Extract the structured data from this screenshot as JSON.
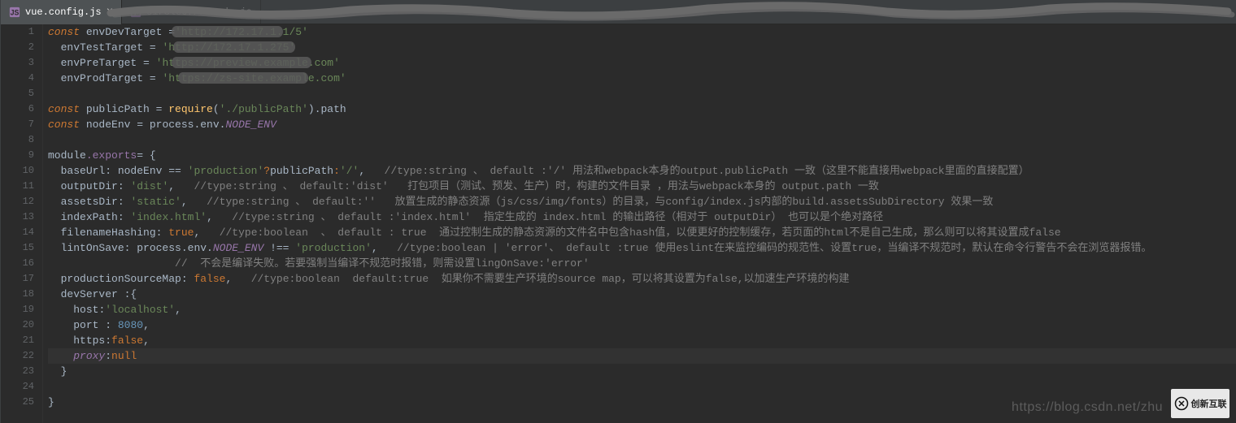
{
  "tabs": {
    "active": {
      "label": "vue.config.js"
    },
    "second": {
      "label": "circleOfFriends.js"
    }
  },
  "code": {
    "l1_const": "const",
    "l1_var": "envDevTarget",
    "l1_eq": " =",
    "l1_str": "'http://172.17.1.1/5'",
    "l2_var": "envTestTarget",
    "l2_eq": " = ",
    "l2_str": "'http://172.17.1.275'",
    "l3_var": "envPreTarget",
    "l3_eq": " = ",
    "l3_str": "'https://preview.example.com'",
    "l4_var": "envProdTarget",
    "l4_eq": " = ",
    "l4_str": "'https://zs-site.example.com'",
    "l6_const": "const",
    "l6_var": "publicPath",
    "l6_eq": " = ",
    "l6_req": "require",
    "l6_arg": "'./publicPath'",
    "l6_tail": ").path",
    "l7_const": "const",
    "l7_var": "nodeEnv",
    "l7_eq": " = process.env.",
    "l7_env": "NODE_ENV",
    "l9_mod": "module",
    "l9_exp": ".exports",
    "l9_tail": "= {",
    "l10_key": "baseUrl",
    "l10_mid": ": nodeEnv == ",
    "l10_prod": "'production'",
    "l10_q": "?",
    "l10_pp": "publicPath",
    "l10_c": ":",
    "l10_root": "'/'",
    "l10_end": ",   ",
    "l10_cmt": "//type:string 、 default :'/' 用法和webpack本身的output.publicPath 一致（这里不能直接用webpack里面的直接配置）",
    "l11_key": "outputDir",
    "l11_c": ": ",
    "l11_val": "'dist'",
    "l11_end": ",   ",
    "l11_cmt": "//type:string 、 default:'dist'   打包项目（测试、预发、生产）时，构建的文件目录 ，用法与webpack本身的 output.path 一致",
    "l12_key": "assetsDir",
    "l12_c": ": ",
    "l12_val": "'static'",
    "l12_end": ",   ",
    "l12_cmt": "//type:string 、 default:''   放置生成的静态资源（js/css/img/fonts）的目录，与config/index.js内部的build.assetsSubDirectory 效果一致",
    "l13_key": "indexPath",
    "l13_c": ": ",
    "l13_val": "'index.html'",
    "l13_end": ",   ",
    "l13_cmt": "//type:string 、 default :'index.html'  指定生成的 index.html 的输出路径（相对于 outputDir） 也可以是个绝对路径",
    "l14_key": "filenameHashing",
    "l14_c": ": ",
    "l14_val": "true",
    "l14_end": ",   ",
    "l14_cmt": "//type:boolean  、 default : true  通过控制生成的静态资源的文件名中包含hash值，以便更好的控制缓存，若页面的html不是自己生成，那么则可以将其设置成false",
    "l15_key": "lintOnSave",
    "l15_c": ": process.env.",
    "l15_env": "NODE_ENV",
    "l15_neq": " !== ",
    "l15_val": "'production'",
    "l15_end": ",   ",
    "l15_cmt": "//type:boolean | 'error'、 default :true 使用eslint在来监控编码的规范性、设置true，当编译不规范时，默认在命令行警告不会在浏览器报错。",
    "l16_cmt": "//  不会是编译失败。若要强制当编译不规范时报错，则需设置lingOnSave:'error'",
    "l17_key": "productionSourceMap",
    "l17_c": ": ",
    "l17_val": "false",
    "l17_end": ",   ",
    "l17_cmt": "//type:boolean  default:true  如果你不需要生产环境的source map，可以将其设置为false,以加速生产环境的构建",
    "l18_key": "devServer",
    "l18_tail": " :{",
    "l19_key": "host",
    "l19_c": ":",
    "l19_val": "'localhost'",
    "l19_end": ",",
    "l20_key": "port",
    "l20_c": " : ",
    "l20_val": "8080",
    "l20_end": ",",
    "l21_key": "https",
    "l21_c": ":",
    "l21_val": "false",
    "l21_end": ",",
    "l22_key": "proxy",
    "l22_c": ":",
    "l22_val": "null",
    "l23": "}",
    "l25": "}"
  },
  "gutter": [
    "1",
    "2",
    "3",
    "4",
    "5",
    "6",
    "7",
    "8",
    "9",
    "10",
    "11",
    "12",
    "13",
    "14",
    "15",
    "16",
    "17",
    "18",
    "19",
    "20",
    "21",
    "22",
    "23",
    "24",
    "25"
  ],
  "watermark": "https://blog.csdn.net/zhu",
  "logo_text": "创新互联"
}
